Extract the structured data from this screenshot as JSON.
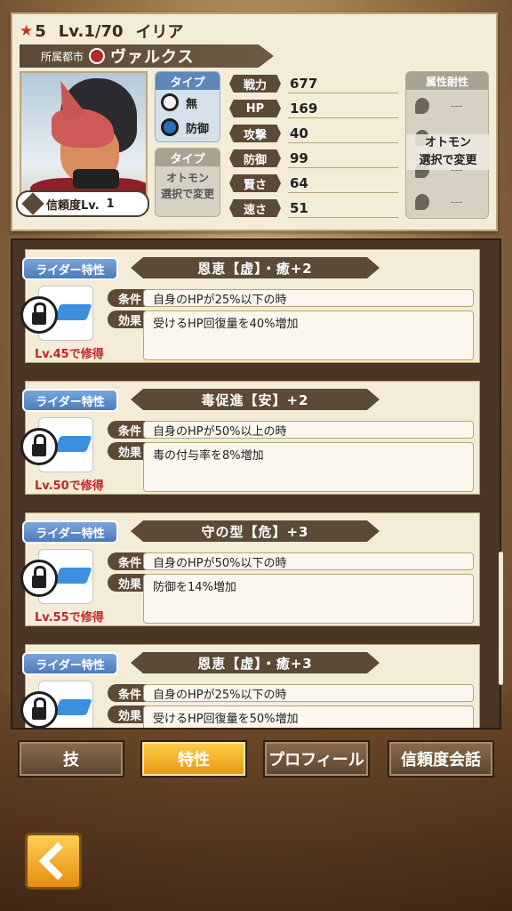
{
  "header": {
    "rarity": "5",
    "level": "Lv.1/70",
    "name": "イリア",
    "city_label": "所属都市",
    "city_name": "ヴァルクス",
    "trust": {
      "label": "信頼度Lv.",
      "value": "1"
    }
  },
  "type_panel": {
    "title": "タイプ",
    "rows": [
      {
        "icon": "neutral-icon",
        "label": "無"
      },
      {
        "icon": "defense-icon",
        "label": "防御"
      }
    ],
    "otomon_title": "タイプ",
    "otomon_note": "オトモン\n選択で変更",
    "otomon_value": "---"
  },
  "stats": [
    {
      "label": "戦力",
      "value": "677"
    },
    {
      "label": "HP",
      "value": "169"
    },
    {
      "label": "攻撃",
      "value": "40"
    },
    {
      "label": "防御",
      "value": "99"
    },
    {
      "label": "賢さ",
      "value": "64"
    },
    {
      "label": "速さ",
      "value": "51"
    }
  ],
  "attributes": {
    "title": "属性耐性",
    "note": "オトモン\n選択で変更",
    "rows": [
      {
        "value": "---"
      },
      {
        "value": "---"
      },
      {
        "value": "---"
      },
      {
        "value": "---"
      }
    ]
  },
  "trait_list": {
    "tag_label": "ライダー特性",
    "cond_label": "条件",
    "eff_label": "効果",
    "items": [
      {
        "title": "恩恵【虚】・癒+2",
        "condition": "自身のHPが25%以下の時",
        "effect": "受けるHP回復量を40%増加",
        "requirement": "Lv.45で修得"
      },
      {
        "title": "毒促進【安】+2",
        "condition": "自身のHPが50%以上の時",
        "effect": "毒の付与率を8%増加",
        "requirement": "Lv.50で修得"
      },
      {
        "title": "守の型【危】+3",
        "condition": "自身のHPが50%以下の時",
        "effect": "防御を14%増加",
        "requirement": "Lv.55で修得"
      },
      {
        "title": "恩恵【虚】・癒+3",
        "condition": "自身のHPが25%以下の時",
        "effect": "受けるHP回復量を50%増加",
        "requirement": ""
      }
    ]
  },
  "tabs": [
    {
      "label": "技",
      "active": false
    },
    {
      "label": "特性",
      "active": true
    },
    {
      "label": "プロフィール",
      "active": false
    },
    {
      "label": "信頼度会話",
      "active": false
    }
  ],
  "colors": {
    "accent": "#e5950f",
    "panel": "#f3ecd9",
    "label_bg": "#5c4a38",
    "tag_blue": "#4d7bbb",
    "req_red": "#c1272d"
  }
}
